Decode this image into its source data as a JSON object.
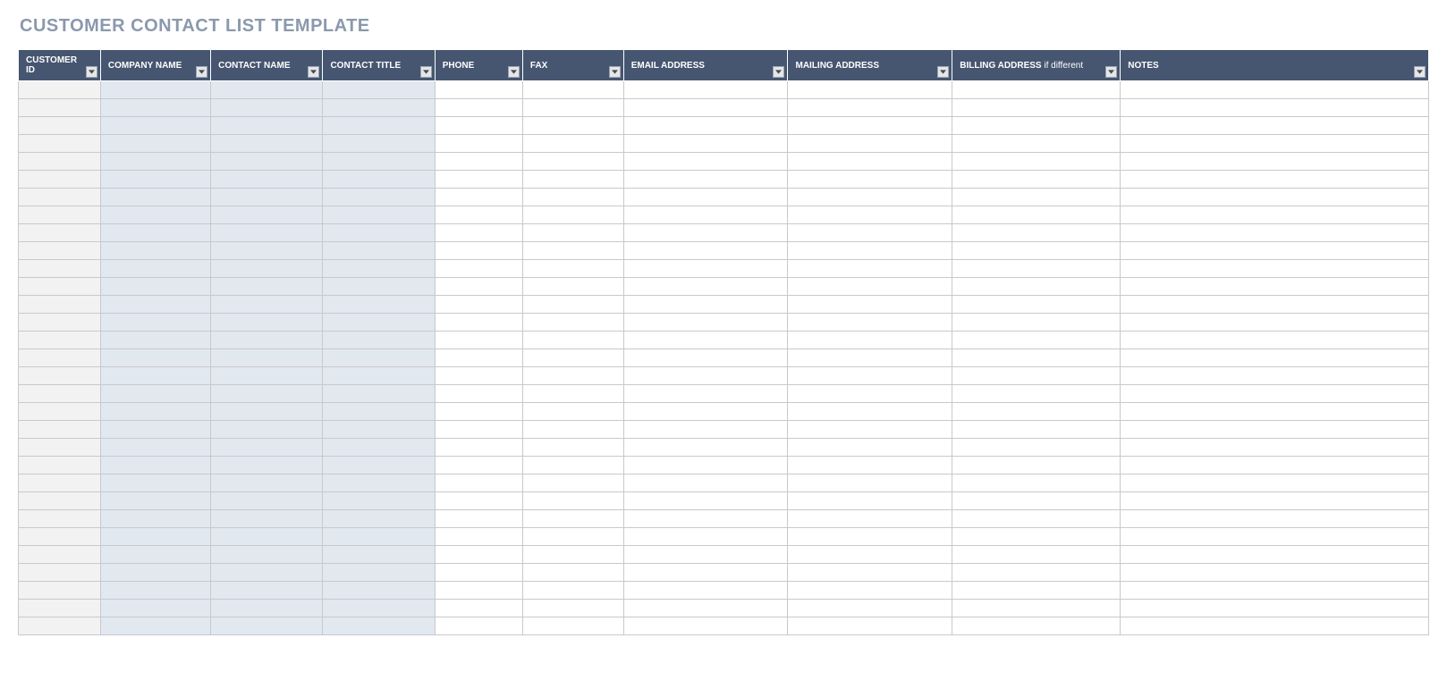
{
  "title": "CUSTOMER CONTACT LIST TEMPLATE",
  "columns": [
    {
      "label": "CUSTOMER ID",
      "sub": "",
      "shade": "id"
    },
    {
      "label": "COMPANY NAME",
      "sub": "",
      "shade": "blue"
    },
    {
      "label": "CONTACT NAME",
      "sub": "",
      "shade": "blue"
    },
    {
      "label": "CONTACT TITLE",
      "sub": "",
      "shade": "blue"
    },
    {
      "label": "PHONE",
      "sub": "",
      "shade": "plain"
    },
    {
      "label": "FAX",
      "sub": "",
      "shade": "plain"
    },
    {
      "label": "EMAIL ADDRESS",
      "sub": "",
      "shade": "plain"
    },
    {
      "label": "MAILING ADDRESS",
      "sub": "",
      "shade": "plain"
    },
    {
      "label": "BILLING ADDRESS",
      "sub": "if different",
      "shade": "plain"
    },
    {
      "label": "NOTES",
      "sub": "",
      "shade": "plain"
    }
  ],
  "row_count": 31,
  "rows": []
}
